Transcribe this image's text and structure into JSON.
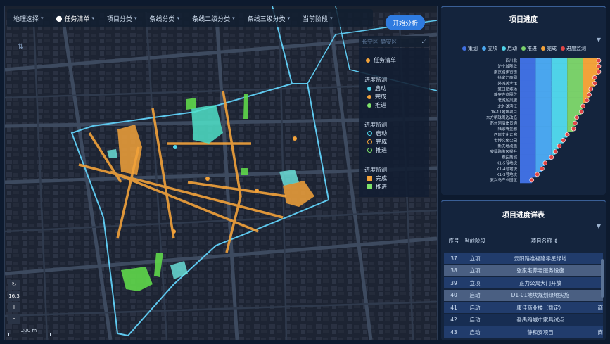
{
  "toolbar": {
    "items": [
      "地理选择",
      "任务清单",
      "项目分类",
      "条线分类",
      "条线二级分类",
      "条线三级分类",
      "当前阶段"
    ],
    "start_button": "开始分析"
  },
  "district": {
    "label": "长宁区 静安区"
  },
  "legend": {
    "task_list": "任务清单",
    "group1_title": "进度监测",
    "group1": [
      {
        "label": "启动",
        "color": "#4fd3e8"
      },
      {
        "label": "完成",
        "color": "#f2a23a"
      },
      {
        "label": "推进",
        "color": "#7ee36a"
      }
    ],
    "group2_title": "进度监测",
    "group2": [
      {
        "label": "启动",
        "color": "#4fd3e8"
      },
      {
        "label": "完成",
        "color": "#f2a23a"
      },
      {
        "label": "推进",
        "color": "#7ee36a"
      }
    ],
    "group3_title": "进度监测",
    "group3": [
      {
        "label": "完成",
        "color": "#f2a23a"
      },
      {
        "label": "推进",
        "color": "#7ee36a"
      }
    ]
  },
  "map_controls": {
    "zoom": "16.3",
    "plus": "+",
    "minus": "-",
    "scale": "200 m"
  },
  "progress_panel": {
    "title": "项目进度",
    "colors": {
      "planning": "#3f6fe0",
      "approval": "#4aa6ee",
      "start": "#4fd3e8",
      "advance": "#7ad06a",
      "complete": "#f2a23a",
      "monitor": "#e04646"
    },
    "chart_data": {
      "type": "bar",
      "stacked": true,
      "orientation": "horizontal",
      "legend": [
        "策划",
        "立项",
        "启动",
        "推进",
        "完成",
        "进度监测"
      ],
      "categories": [
        "四川北",
        "沪宁城际铁",
        "南京路步行街",
        "徐家汇商圈",
        "外滩美术馆",
        "虹口足球场",
        "静安寺商圈改",
        "老城厢风貌",
        "北外滩滨江",
        "1K-11地块项目",
        "东方明珠周边改造",
        "苏州河沿岸贯通",
        "陆家嘴金融",
        "西岸文化走廊",
        "世博文化公园",
        "新天地改造",
        "安福路街区提升",
        "豫园商城",
        "K1-5号地块",
        "K1-4号地块",
        "K1-3号地块",
        "复兴岛产业园区"
      ],
      "values": [
        100,
        100,
        100,
        95,
        95,
        90,
        88,
        85,
        80,
        78,
        72,
        70,
        68,
        60,
        55,
        50,
        45,
        40,
        32,
        28,
        22,
        15
      ]
    }
  },
  "detail_panel": {
    "title": "项目进度详表",
    "headers": {
      "index": "序号",
      "stage": "当前阶段",
      "name": "项目名称 ⇕"
    },
    "rows": [
      {
        "index": "37",
        "stage": "立项",
        "name": "云阳路准福路零星绿地",
        "extra": ""
      },
      {
        "index": "38",
        "stage": "立项",
        "name": "张家宅养老服务设施",
        "extra": ""
      },
      {
        "index": "39",
        "stage": "立项",
        "name": "正力公寓大门开放",
        "extra": ""
      },
      {
        "index": "40",
        "stage": "启动",
        "name": "D1-01地块规划绿地实施",
        "extra": ""
      },
      {
        "index": "41",
        "stage": "启动",
        "name": "康佳商业楼（暂定）",
        "extra": "商"
      },
      {
        "index": "42",
        "stage": "启动",
        "name": "番禺路城市家具试点",
        "extra": ""
      },
      {
        "index": "43",
        "stage": "启动",
        "name": "静和安项目",
        "extra": "商"
      }
    ]
  }
}
